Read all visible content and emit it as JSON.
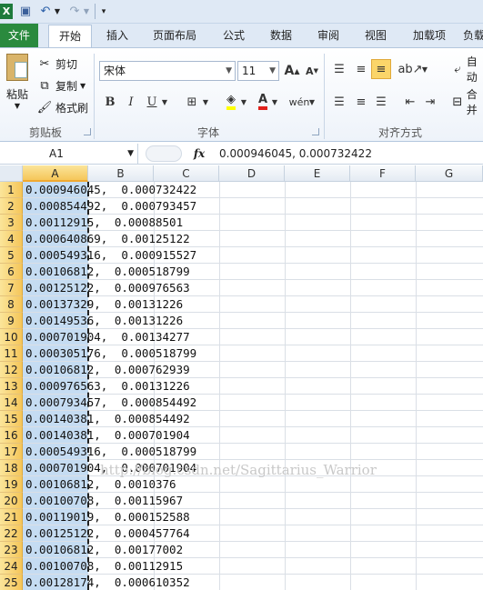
{
  "app_icon": "excel-icon",
  "qat": {
    "undo": "↶",
    "redo": "↷"
  },
  "tabs": [
    "文件",
    "开始",
    "插入",
    "页面布局",
    "公式",
    "数据",
    "审阅",
    "视图",
    "加载项",
    "负载"
  ],
  "active_tab": "开始",
  "clipboard": {
    "paste": "粘贴",
    "cut": "剪切",
    "copy": "复制",
    "format_painter": "格式刷",
    "label": "剪贴板"
  },
  "font": {
    "name": "宋体",
    "size": "11",
    "label": "字体",
    "bold": "B",
    "italic": "I",
    "underline": "U"
  },
  "alignment": {
    "label": "对齐方式",
    "wrap": "自动",
    "merge": "合并"
  },
  "formula_bar": {
    "name_box": "A1",
    "fx": "fx",
    "content": "0.000946045,  0.000732422"
  },
  "columns": [
    "A",
    "B",
    "C",
    "D",
    "E",
    "F",
    "G"
  ],
  "selected_column": "A",
  "rows": [
    {
      "n": "1",
      "text": "0.000946045,  0.000732422"
    },
    {
      "n": "2",
      "text": "0.000854492,  0.000793457"
    },
    {
      "n": "3",
      "text": "0.00112915,  0.00088501"
    },
    {
      "n": "4",
      "text": "0.000640869,  0.00125122"
    },
    {
      "n": "5",
      "text": "0.000549316,  0.000915527"
    },
    {
      "n": "6",
      "text": "0.00106812,  0.000518799"
    },
    {
      "n": "7",
      "text": "0.00125122,  0.000976563"
    },
    {
      "n": "8",
      "text": "0.00137329,  0.00131226"
    },
    {
      "n": "9",
      "text": "0.00149536,  0.00131226"
    },
    {
      "n": "10",
      "text": "0.000701904,  0.00134277"
    },
    {
      "n": "11",
      "text": "0.000305176,  0.000518799"
    },
    {
      "n": "12",
      "text": "0.00106812,  0.000762939"
    },
    {
      "n": "13",
      "text": "0.000976563,  0.00131226"
    },
    {
      "n": "14",
      "text": "0.000793457,  0.000854492"
    },
    {
      "n": "15",
      "text": "0.00140381,  0.000854492"
    },
    {
      "n": "16",
      "text": "0.00140381,  0.000701904"
    },
    {
      "n": "17",
      "text": "0.000549316,  0.000518799"
    },
    {
      "n": "18",
      "text": "0.000701904,  0.000701904"
    },
    {
      "n": "19",
      "text": "0.00106812,  0.0010376"
    },
    {
      "n": "20",
      "text": "0.00100708,  0.00115967"
    },
    {
      "n": "21",
      "text": "0.00119019,  0.000152588"
    },
    {
      "n": "22",
      "text": "0.00125122,  0.000457764"
    },
    {
      "n": "23",
      "text": "0.00106812,  0.00177002"
    },
    {
      "n": "24",
      "text": "0.00100708,  0.00112915"
    },
    {
      "n": "25",
      "text": "0.00128174,  0.000610352"
    }
  ],
  "watermark": "http://blog.csdn.net/Sagittarius_Warrior",
  "colors": {
    "file_tab": "#2a8a3e",
    "selection": "#c5dcf2",
    "header_highlight": "#f5c65a"
  }
}
